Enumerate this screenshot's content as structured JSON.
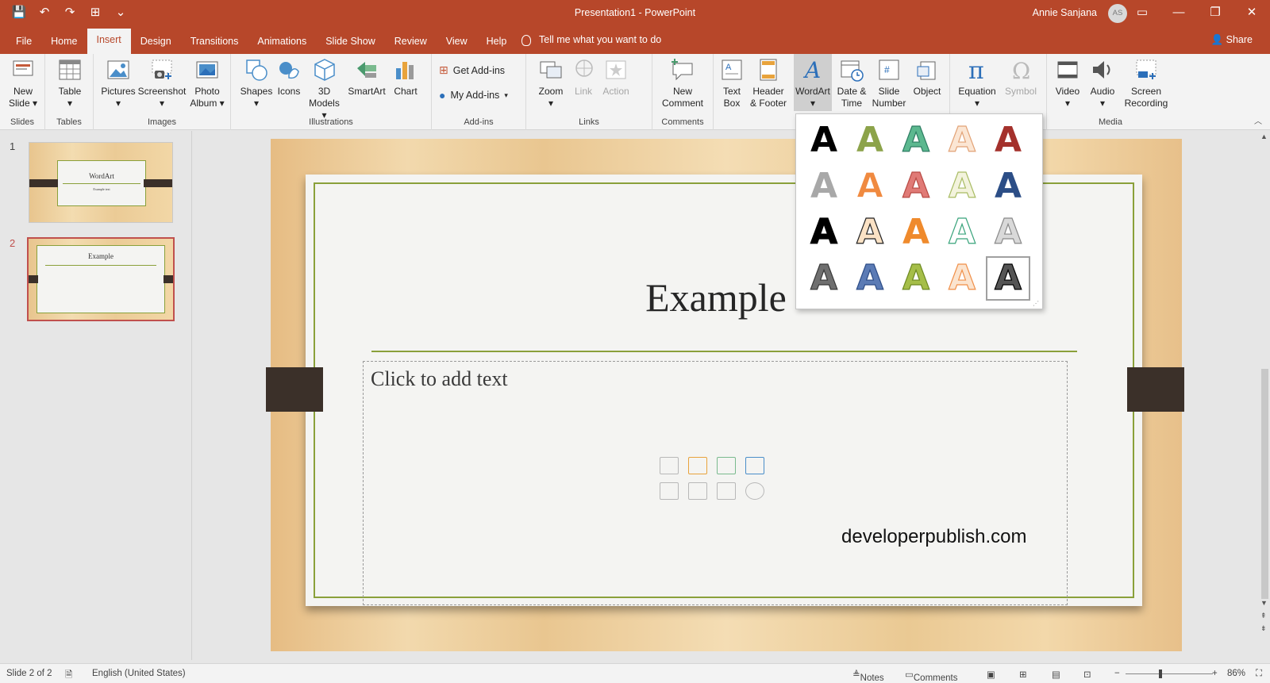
{
  "window": {
    "title": "Presentation1  -  PowerPoint",
    "user_name": "Annie Sanjana",
    "user_initials": "AS",
    "min": "—",
    "restore": "❐",
    "close": "✕"
  },
  "qat": {
    "save": "💾",
    "undo": "↶",
    "redo": "↷",
    "present": "⊞",
    "more": "⌄"
  },
  "tabs": [
    "File",
    "Home",
    "Insert",
    "Design",
    "Transitions",
    "Animations",
    "Slide Show",
    "Review",
    "View",
    "Help"
  ],
  "tell_me": "Tell me what you want to do",
  "share": "Share",
  "ribbon": {
    "groups": {
      "slides": "Slides",
      "tables": "Tables",
      "images": "Images",
      "illustrations": "Illustrations",
      "addins": "Add-ins",
      "links": "Links",
      "comments": "Comments",
      "media": "Media"
    },
    "commands": {
      "new_slide": [
        "New",
        "Slide ▾"
      ],
      "table": [
        "Table",
        "▾"
      ],
      "pictures": [
        "Pictures",
        "▾"
      ],
      "screenshot": [
        "Screenshot",
        "▾"
      ],
      "photo_album": [
        "Photo",
        "Album ▾"
      ],
      "shapes": [
        "Shapes",
        "▾"
      ],
      "icons": "Icons",
      "models3d": [
        "3D",
        "Models ▾"
      ],
      "smartart": "SmartArt",
      "chart": "Chart",
      "get_addins": "Get Add-ins",
      "my_addins": "My Add-ins",
      "zoom": [
        "Zoom",
        "▾"
      ],
      "link": "Link",
      "action": "Action",
      "new_comment": [
        "New",
        "Comment"
      ],
      "text_box": [
        "Text",
        "Box"
      ],
      "header_footer": [
        "Header",
        "& Footer"
      ],
      "wordart": [
        "WordArt",
        "▾"
      ],
      "date_time": [
        "Date &",
        "Time"
      ],
      "slide_number": [
        "Slide",
        "Number"
      ],
      "object": "Object",
      "equation": [
        "Equation",
        "▾"
      ],
      "symbol": "Symbol",
      "video": [
        "Video",
        "▾"
      ],
      "audio": [
        "Audio",
        "▾"
      ],
      "screen_recording": [
        "Screen",
        "Recording"
      ]
    }
  },
  "slides": [
    {
      "number": "1",
      "title": "WordArt",
      "subtitle": "Example text"
    },
    {
      "number": "2",
      "title": "Example"
    }
  ],
  "slide": {
    "title": "Example",
    "placeholder": "Click to add text",
    "watermark": "developerpublish.com"
  },
  "wordart_gallery": {
    "glyph": "A",
    "styles": [
      {
        "fill": "#000000",
        "stroke": "none"
      },
      {
        "fill": "#8ca34a",
        "stroke": "none"
      },
      {
        "fill": "#5cb88f",
        "stroke": "#2e7d63"
      },
      {
        "fill": "#fbe6d4",
        "stroke": "#e2a377"
      },
      {
        "fill": "#a4312c",
        "stroke": "none"
      },
      {
        "fill": "#a8a8a8",
        "stroke": "none"
      },
      {
        "fill": "#f08a40",
        "stroke": "#fff"
      },
      {
        "fill": "#e07a76",
        "stroke": "#b84a44"
      },
      {
        "fill": "#f3f3dd",
        "stroke": "#a9bc64"
      },
      {
        "fill": "#2c4e86",
        "stroke": "none"
      },
      {
        "fill": "#000000",
        "stroke": "#000000"
      },
      {
        "fill": "#fbe2c5",
        "stroke": "#222222"
      },
      {
        "fill": "#ef8a2c",
        "stroke": "none"
      },
      {
        "fill": "#ffffff",
        "stroke": "#3aa47c"
      },
      {
        "fill": "#d9d9d9",
        "stroke": "#8a8a8a"
      },
      {
        "fill": "#6f6f6f",
        "stroke": "#3a3a3a"
      },
      {
        "fill": "#5b7bb5",
        "stroke": "#2d4d87"
      },
      {
        "fill": "#a5be48",
        "stroke": "#6e8a22"
      },
      {
        "fill": "#fbe4cf",
        "stroke": "#f0904a"
      },
      {
        "fill": "#555555",
        "stroke": "#000000"
      }
    ]
  },
  "status": {
    "slide": "Slide 2 of 2",
    "language": "English (United States)",
    "notes": "Notes",
    "comments": "Comments",
    "zoom": "86%"
  },
  "colors": {
    "accent": "#b7472a",
    "frame": "#8aa03a",
    "ribbon_bg": "#f3f3f3"
  }
}
